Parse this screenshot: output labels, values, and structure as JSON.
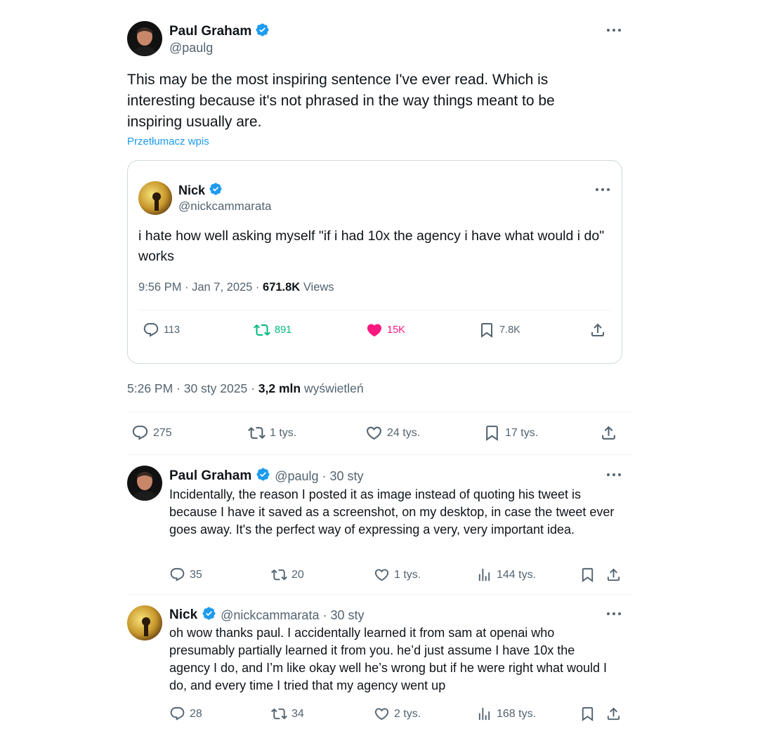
{
  "main_tweet": {
    "author_name": "Paul Graham",
    "author_handle": "@paulg",
    "text": "This may be the most inspiring sentence I've ever read. Which is interesting because it's not phrased in the way things meant to be inspiring usually are.",
    "translate_label": "Przetłumacz wpis",
    "timestamp": "5:26 PM · 30 sty 2025 · ",
    "views_count": "3,2 mln",
    "views_label": "wyświetleń",
    "replies": "275",
    "reposts": "1 tys.",
    "likes": "24 tys.",
    "bookmarks": "17 tys."
  },
  "quoted_tweet": {
    "author_name": "Nick",
    "author_handle": "@nickcammarata",
    "text": "i hate how well asking myself \"if i had 10x the agency i have what would i do\" works",
    "timestamp": "9:56 PM · Jan 7, 2025 · ",
    "views_count": "671.8K",
    "views_label": "Views",
    "replies": "113",
    "reposts": "891",
    "likes": "15K",
    "bookmarks": "7.8K"
  },
  "replies": [
    {
      "author_name": "Paul Graham",
      "meta": "@paulg · 30 sty",
      "text": "Incidentally, the reason I posted it as image instead of quoting his tweet is because I have it saved as a screenshot, on my desktop, in case the tweet ever goes away. It's the perfect way of expressing a very, very important idea.",
      "replies": "35",
      "reposts": "20",
      "likes": "1 tys.",
      "views": "144 tys."
    },
    {
      "author_name": "Nick",
      "meta": "@nickcammarata · 30 sty",
      "text": "oh wow thanks paul. I accidentally learned it from sam at openai who presumably partially learned it from you. he’d just assume I have 10x the agency I do, and I’m like okay well he’s wrong but if he were right what would I do, and every time I tried that my agency went up",
      "replies": "28",
      "reposts": "34",
      "likes": "2 tys.",
      "views": "168 tys."
    }
  ],
  "colors": {
    "accent_blue": "#1d9bf0",
    "repost_green": "#00ba7c",
    "like_pink": "#f91880",
    "muted_gray": "#536471"
  },
  "icons": [
    "verified-badge-icon",
    "more-icon",
    "reply-icon",
    "repost-icon",
    "like-icon",
    "bookmark-icon",
    "share-icon",
    "views-icon"
  ]
}
